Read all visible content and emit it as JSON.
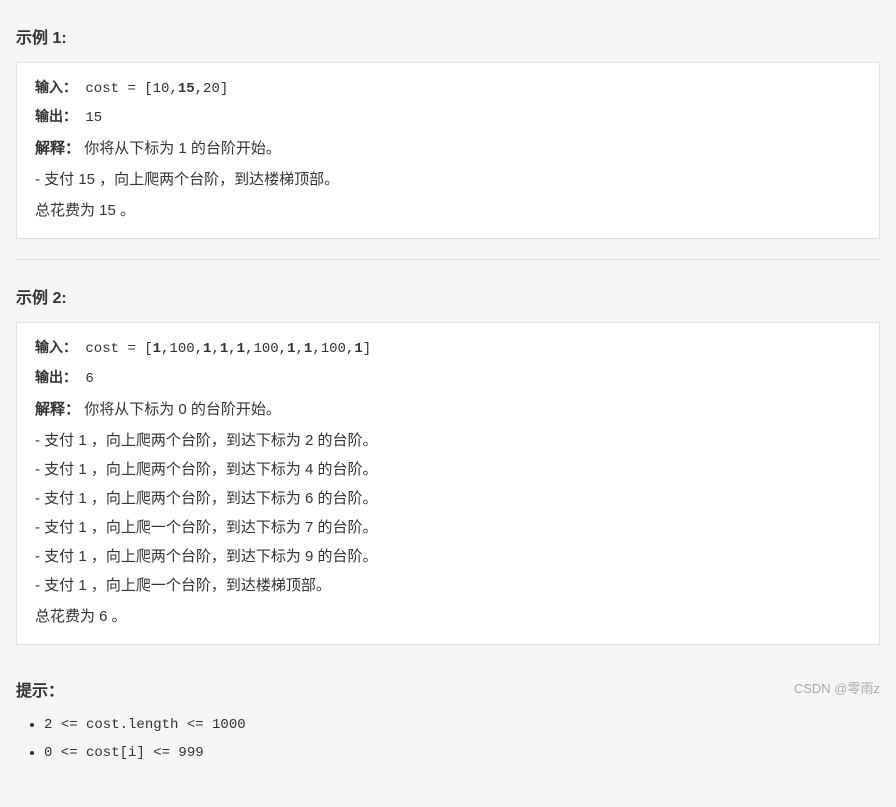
{
  "example1": {
    "title": "示例 1:",
    "input_label": "输入：",
    "input_code": "cost = [10,",
    "input_bold": "15",
    "input_rest": ",20]",
    "input_full": "cost = [10,15,20]",
    "output_label": "输出：",
    "output_value": "15",
    "explain_label": "解释：",
    "explain_text": "你将从下标为 1 的台阶开始。",
    "detail1": "- 支付 15 ，向上爬两个台阶，到达楼梯顶部。",
    "total": "总花费为 15 。"
  },
  "example2": {
    "title": "示例 2:",
    "input_label": "输入：",
    "input_full": "cost = [1,100,1,1,1,100,1,1,100,1]",
    "output_label": "输出：",
    "output_value": "6",
    "explain_label": "解释：",
    "explain_text": "你将从下标为 0 的台阶开始。",
    "detail1": "- 支付 1 ，向上爬两个台阶，到达下标为 2 的台阶。",
    "detail2": "- 支付 1 ，向上爬两个台阶，到达下标为 4 的台阶。",
    "detail3": "- 支付 1 ，向上爬两个台阶，到达下标为 6 的台阶。",
    "detail4": "- 支付 1 ，向上爬一个台阶，到达下标为 7 的台阶。",
    "detail5": "- 支付 1 ，向上爬两个台阶，到达下标为 9 的台阶。",
    "detail6": "- 支付 1 ，向上爬一个台阶，到达楼梯顶部。",
    "total": "总花费为 6 。"
  },
  "hints": {
    "title": "提示：",
    "item1": "2 <= cost.length <= 1000",
    "item2": "0 <= cost[i] <= 999"
  },
  "watermark": "CSDN @零雨z"
}
